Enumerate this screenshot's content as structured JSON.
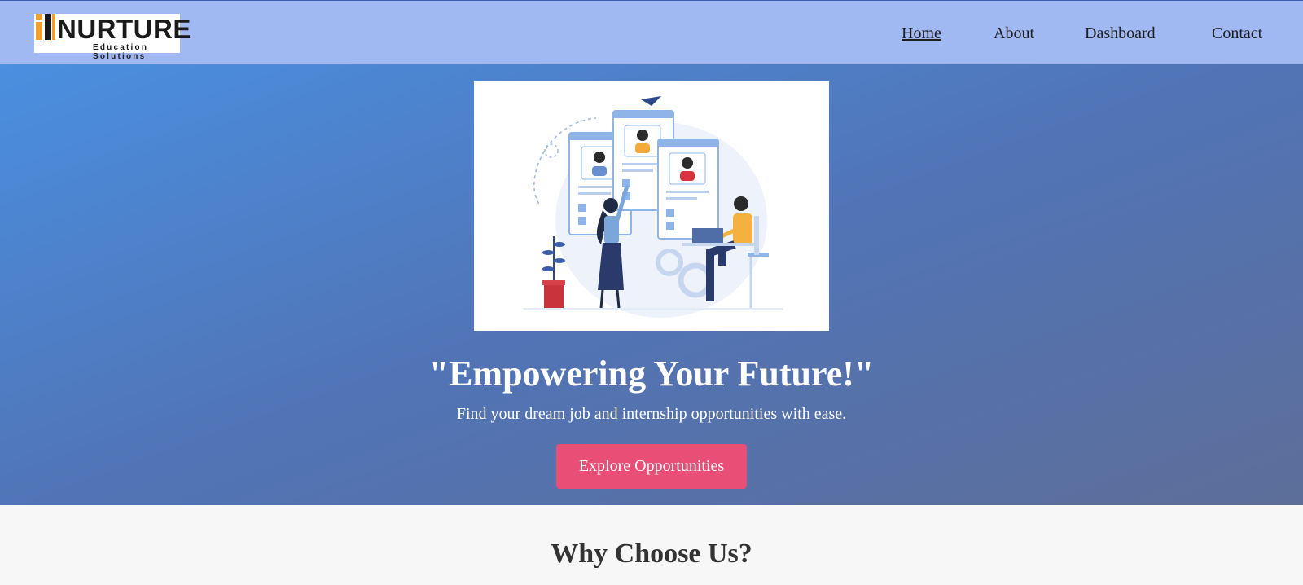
{
  "brand": {
    "logo_word": "NURTURE",
    "logo_sub": "Education Solutions"
  },
  "nav": {
    "items": [
      {
        "label": "Home",
        "active": true
      },
      {
        "label": "About",
        "active": false
      },
      {
        "label": "Dashboard",
        "active": false
      },
      {
        "label": "Contact",
        "active": false
      }
    ]
  },
  "hero": {
    "image_icon": "job-recruitment-illustration",
    "title": "\"Empowering Your Future!\"",
    "subtitle": "Find your dream job and internship opportunities with ease.",
    "cta_label": "Explore Opportunities"
  },
  "why": {
    "title": "Why Choose Us?"
  },
  "colors": {
    "header_bg": "#a0b9f2",
    "hero_gradient_start": "#4a8fe0",
    "hero_gradient_end": "#5d6e99",
    "cta_bg": "#e94e77",
    "section_bg": "#f7f7f7",
    "logo_accent": "#f0a030"
  }
}
